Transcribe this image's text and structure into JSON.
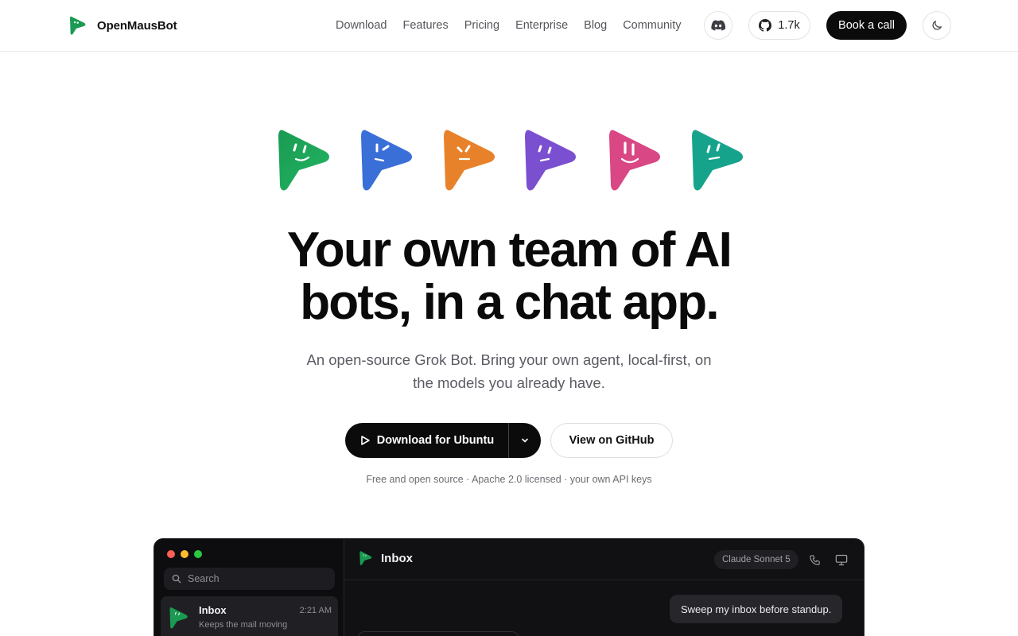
{
  "nav": {
    "brand": "OpenMausBot",
    "links": [
      "Download",
      "Features",
      "Pricing",
      "Enterprise",
      "Blog",
      "Community"
    ],
    "github_stars": "1.7k",
    "cta": "Book a call",
    "icons": {
      "discord": "discord-icon",
      "github": "github-icon",
      "theme": "moon-icon"
    }
  },
  "hero": {
    "bot_colors": [
      "#1a9a52",
      "#3b6fd8",
      "#e8822a",
      "#7a4fd0",
      "#d94784",
      "#16a38c"
    ],
    "headline": "Your own team of AI bots, in a chat app.",
    "subtitle": "An open-source Grok Bot. Bring your own agent, local-first, on the models you already have.",
    "download_label": "Download for Ubuntu",
    "github_label": "View on GitHub",
    "note": "Free and open source · Apache 2.0 licensed · your own API keys"
  },
  "app": {
    "window_dots": [
      "#ff5f57",
      "#febc2e",
      "#28c840"
    ],
    "search_placeholder": "Search",
    "thread": {
      "title": "Inbox",
      "time": "2:21 AM",
      "snippet": "Keeps the mail moving"
    },
    "header_title": "Inbox",
    "model": "Claude Sonnet 5",
    "user_message": "Sweep my inbox before standup."
  }
}
